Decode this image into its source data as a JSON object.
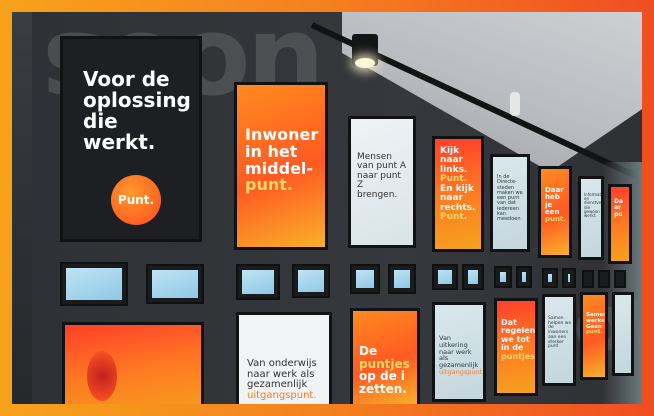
{
  "posters": {
    "p1": {
      "line1": "Voor de",
      "line2": "oplossing",
      "line3": "die werkt.",
      "badge": "Punt."
    },
    "p2": {
      "line1": "Inwoner",
      "line2": "in het",
      "line3": "middel-",
      "line4": "punt."
    },
    "p3": {
      "line1": "Mensen",
      "line2": "van punt A",
      "line3": "naar punt Z",
      "line4": "brengen."
    },
    "p4": {
      "line1": "Kijk",
      "line2": "naar links.",
      "line3": "Punt.",
      "line4": "En kijk",
      "line5": "naar",
      "line6": "rechts.",
      "line7": "Punt."
    },
    "p5": {
      "text": "In de Directe-steden maken we een punt van dat iedereen kan meedoen"
    },
    "p6": {
      "line1": "Daar",
      "line2": "heb je",
      "line3": "een",
      "line4": "punt."
    },
    "p7": {
      "text": "Informatie-en dienstverlening die gewoon werkt."
    },
    "p8": {
      "line1": "Da",
      "line2": "ar",
      "line3": "pu"
    },
    "b1": {
      "text": ""
    },
    "b2": {
      "line1": "Van onderwijs",
      "line2": "naar werk als",
      "line3": "gezamenlijk",
      "line4": "uitgangspunt."
    },
    "b3": {
      "line1": "De",
      "line2": "puntjes",
      "line3": "op de i",
      "line4": "zetten."
    },
    "b4": {
      "line1": "Van uitkering",
      "line2": "naar werk als",
      "line3": "gezamenlijk",
      "line4": "uitgangspunt."
    },
    "b5": {
      "line1": "Dat",
      "line2": "regelen",
      "line3": "we tot",
      "line4": "in de",
      "line5": "puntjes"
    },
    "b6": {
      "text": "Samen helpen we de inwoners aan een sterker punt"
    },
    "b7": {
      "line1": "Samen-",
      "line2": "werken?",
      "line3": "Geen",
      "line4": "punt."
    }
  },
  "wall": {
    "letters": "soon",
    "letters2": "on"
  },
  "colors": {
    "frame_start": "#f7a21b",
    "frame_end": "#ef4e22",
    "accent": "#ff7a1f"
  }
}
